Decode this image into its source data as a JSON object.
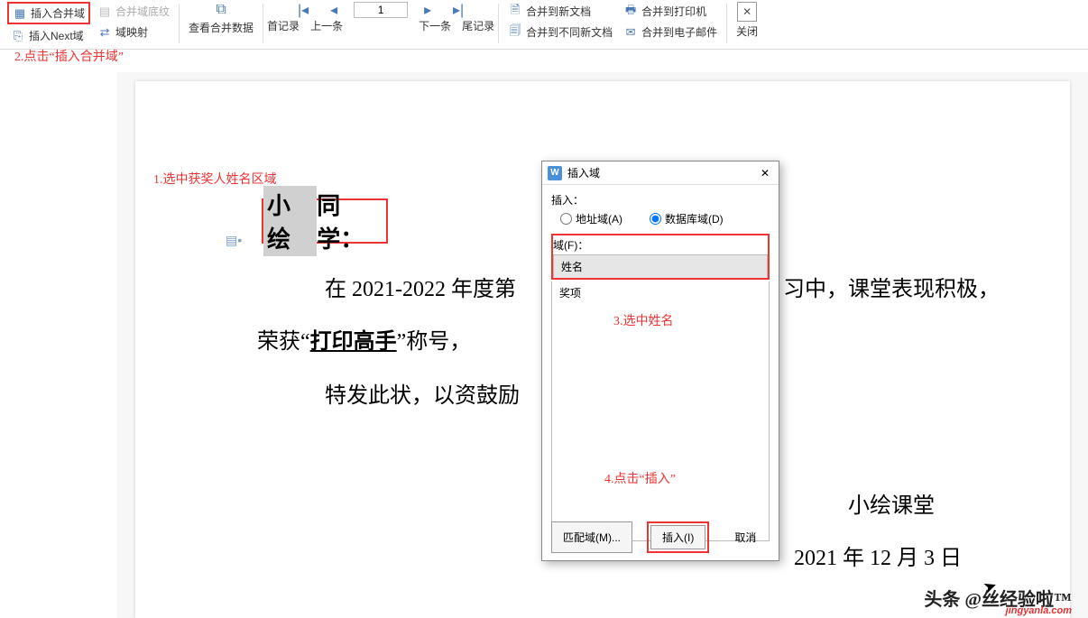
{
  "toolbar": {
    "insert_merge_field": "插入合并域",
    "merge_field_shading": "合并域底纹",
    "insert_next_field": "插入Next域",
    "field_mapping": "域映射",
    "view_merge_data": "查看合并数据",
    "first_record": "首记录",
    "prev_record": "上一条",
    "page_value": "1",
    "next_record": "下一条",
    "last_record": "尾记录",
    "merge_new_doc": "合并到新文档",
    "merge_diff_doc": "合并到不同新文档",
    "merge_printer": "合并到打印机",
    "merge_email": "合并到电子邮件",
    "close": "关闭"
  },
  "annotations": {
    "a1": "1.选中获奖人姓名区域",
    "a2": "2.点击“插入合并域”",
    "a3": "3.选中姓名",
    "a4": "4.点击“插入”"
  },
  "document": {
    "name_selected": "小绘",
    "name_suffix": "同学：",
    "line1_pre": "在 2021-2022 年度第",
    "line1_post": "习中，课堂表现积极，",
    "line2_pre": "荣获“",
    "line2_award": "打印高手",
    "line2_post": "”称号，",
    "line3": "特发此状，以资鼓励",
    "footer1": "小绘课堂",
    "footer2": "2021 年 12 月 3 日"
  },
  "dialog": {
    "title": "插入域",
    "insert_label": "插入：",
    "radio_address": "地址域(A)",
    "radio_db": "数据库域(D)",
    "field_label": "域(F)：",
    "fields": [
      "姓名",
      "奖项"
    ],
    "btn_match": "匹配域(M)...",
    "btn_insert": "插入(I)",
    "btn_cancel": "取消"
  },
  "watermark": {
    "main": "头条 @丝经验啦™",
    "sub": "jingyanla.com"
  }
}
